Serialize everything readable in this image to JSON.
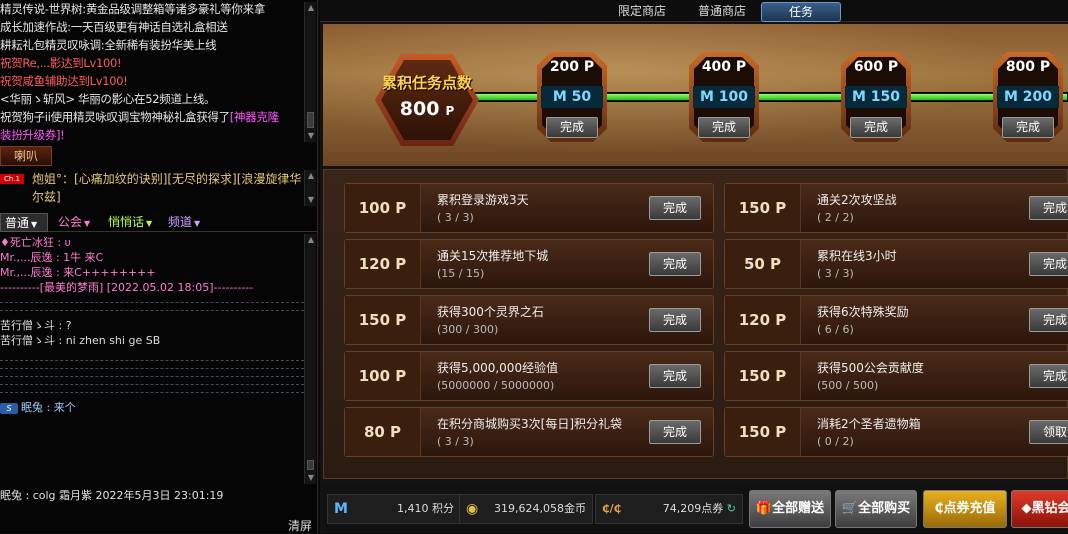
{
  "announcements": [
    {
      "text": "精灵传说-世界树:黄金品级调整箱等诸多豪礼等你来拿",
      "color": "#e6e6e6"
    },
    {
      "text": "成长加速作战:一天百级更有神话自选礼盒相送",
      "color": "#e6e6e6"
    },
    {
      "text": "耕耘礼包精灵叹咏调:全新稀有装扮华美上线",
      "color": "#e6e6e6"
    },
    {
      "text": "祝贺Re,...影达到Lv100!",
      "color": "#ff5a5a"
    },
    {
      "text": "祝贺咸鱼辅助达到Lv100!",
      "color": "#ff5a5a"
    },
    {
      "text": "<华丽ゝ斩风> 华丽の影心在52频道上线。",
      "color": "#e6e6e6"
    },
    {
      "text": "祝贺狗子ii使用精灵咏叹调宝物神秘礼盒获得了",
      "color": "#e6e6e6",
      "highlight": "[神器克隆",
      "highlight_color": "#ff55ff"
    },
    {
      "text": "装扮升级券]!",
      "color": "#ff55ff"
    }
  ],
  "speaker_tab": "喇叭",
  "speaker": {
    "badge": "Ch.1",
    "user": "炮姐°",
    "message": "：[心痛加纹的诀别][无尽的探求][浪漫旋律华尔兹]"
  },
  "channel_tabs": [
    {
      "label": "普通",
      "color": "#fff"
    },
    {
      "label": "公会",
      "color": "#ff7ad0"
    },
    {
      "label": "悄悄话",
      "color": "#b4ff50"
    },
    {
      "label": "频道",
      "color": "#d0a0ff"
    }
  ],
  "chat": [
    {
      "text": "♦死亡冰狂 : υ",
      "color": "#ff7ad0"
    },
    {
      "text": "Mr.,...辰逸 : 1牛   来C",
      "color": "#ff7ad0"
    },
    {
      "text": "Mr.,...辰逸 : 来C++++++++",
      "color": "#ff7ad0"
    },
    {
      "text": "----------[最美的梦雨] [2022.05.02 18:05]----------",
      "color": "#ff7ad0"
    },
    {
      "text": "苦行僧ゝ斗 : ?",
      "color": "#ddd"
    },
    {
      "text": "苦行僧ゝ斗 : ni zhen shi ge SB",
      "color": "#ddd"
    }
  ],
  "chat_last": {
    "icon": "S",
    "user": "眠兔",
    "text": " : 来个",
    "color": "#9ecbff"
  },
  "last_line": "眠兔 : colg 霜月紫   2022年5月3日 23:01:19",
  "clear_label": "清屏",
  "shop_tabs": [
    "限定商店",
    "普通商店",
    "任务"
  ],
  "total": {
    "label": "累积任务点数",
    "value": "800",
    "unit": "P"
  },
  "progress_fraction": 1.0,
  "milestones": [
    {
      "points": "200 P",
      "reward": "M 50",
      "button": "完成"
    },
    {
      "points": "400 P",
      "reward": "M 100",
      "button": "完成"
    },
    {
      "points": "600 P",
      "reward": "M 150",
      "button": "完成"
    },
    {
      "points": "800 P",
      "reward": "M 200",
      "button": "完成"
    }
  ],
  "tasks": [
    {
      "points": "100  P",
      "name": "累积登录游戏3天",
      "progress": "( 3 / 3)",
      "button": "完成"
    },
    {
      "points": "150  P",
      "name": "通关2次攻坚战",
      "progress": "( 2 / 2)",
      "button": "完成"
    },
    {
      "points": "120  P",
      "name": "通关15次推荐地下城",
      "progress": "(15 / 15)",
      "button": "完成"
    },
    {
      "points": "50  P",
      "name": "累积在线3小时",
      "progress": "( 3 / 3)",
      "button": "完成"
    },
    {
      "points": "150  P",
      "name": "获得300个灵界之石",
      "progress": "(300 / 300)",
      "button": "完成"
    },
    {
      "points": "120  P",
      "name": "获得6次特殊奖励",
      "progress": "( 6 / 6)",
      "button": "完成"
    },
    {
      "points": "100  P",
      "name": "获得5,000,000经验值",
      "progress": "(5000000 / 5000000)",
      "button": "完成"
    },
    {
      "points": "150  P",
      "name": "获得500公会贡献度",
      "progress": "(500 / 500)",
      "button": "完成"
    },
    {
      "points": "80  P",
      "name": "在积分商城购买3次[每日]积分礼袋",
      "progress": "( 3 / 3)",
      "button": "完成"
    },
    {
      "points": "150  P",
      "name": "消耗2个圣者遗物箱",
      "progress": "( 0 / 2)",
      "button": "领取"
    }
  ],
  "currency": {
    "mileage": "1,410 积分",
    "gold": "319,624,058金币",
    "cera": "74,209点券"
  },
  "actions": [
    {
      "label": "全部赠送",
      "bg": "linear-gradient(#7a7a7a,#3e3e3e)"
    },
    {
      "label": "全部购买",
      "bg": "linear-gradient(#7a7a7a,#3e3e3e)"
    },
    {
      "label": "点券充值",
      "bg": "linear-gradient(#e8b020,#9a6a08)"
    },
    {
      "label": "黑钻会",
      "bg": "linear-gradient(#e03a2a,#8a1208)"
    }
  ]
}
